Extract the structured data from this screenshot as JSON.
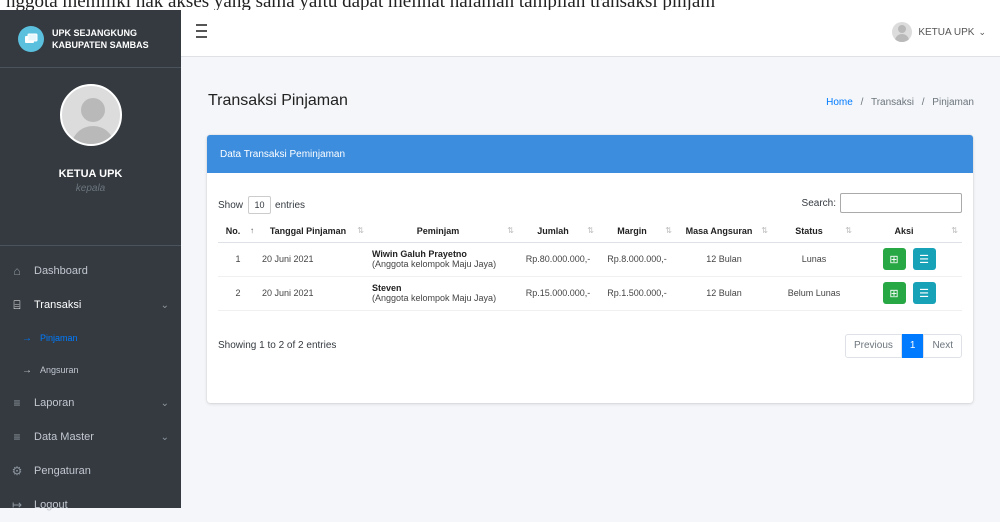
{
  "caption": "nggota memiliki hak akses yang sama yaitu dapat melihat halaman tampilan transaksi pinjam",
  "brand": {
    "line1": "UPK SEJANGKUNG",
    "line2": "KABUPATEN SAMBAS"
  },
  "user_panel": {
    "name": "KETUA UPK",
    "role": "kepala"
  },
  "nav": {
    "dashboard": "Dashboard",
    "transaksi": "Transaksi",
    "pinjaman": "Pinjaman",
    "angsuran": "Angsuran",
    "laporan": "Laporan",
    "data_master": "Data Master",
    "pengaturan": "Pengaturan",
    "logout": "Logout"
  },
  "topbar": {
    "user": "KETUA UPK",
    "caret": "⌄"
  },
  "page": {
    "title": "Transaksi Pinjaman",
    "breadcrumb": {
      "home": "Home",
      "section": "Transaksi",
      "current": "Pinjaman",
      "separator": "/"
    }
  },
  "card": {
    "header": "Data Transaksi Peminjaman"
  },
  "controls": {
    "show_label": "Show",
    "entries_value": "10",
    "entries_label": "entries",
    "search_label": "Search:"
  },
  "table": {
    "headers": [
      "No.",
      "Tanggal Pinjaman",
      "Peminjam",
      "Jumlah",
      "Margin",
      "Masa Angsuran",
      "Status",
      "Aksi"
    ],
    "rows": [
      {
        "no": "1",
        "tanggal": "20 Juni 2021",
        "nama": "Wiwin Galuh Prayetno",
        "kelompok": "(Anggota kelompok Maju Jaya)",
        "jumlah": "Rp.80.000.000,-",
        "margin": "Rp.8.000.000,-",
        "masa": "12 Bulan",
        "status": "Lunas"
      },
      {
        "no": "2",
        "tanggal": "20 Juni 2021",
        "nama": "Steven",
        "kelompok": "(Anggota kelompok Maju Jaya)",
        "jumlah": "Rp.15.000.000,-",
        "margin": "Rp.1.500.000,-",
        "masa": "12 Bulan",
        "status": "Belum Lunas"
      }
    ]
  },
  "footer": {
    "info": "Showing 1 to 2 of 2 entries",
    "previous": "Previous",
    "page": "1",
    "next": "Next"
  },
  "colors": {
    "sidebar": "#343a40",
    "card_header": "#3c8dde",
    "primary": "#007bff",
    "success": "#28a745",
    "info": "#17a2b8"
  }
}
